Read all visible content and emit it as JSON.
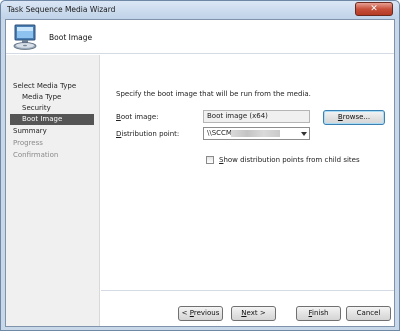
{
  "window": {
    "title": "Task Sequence Media Wizard",
    "close_glyph": "✕"
  },
  "header": {
    "title": "Boot Image",
    "icon": "computer-media-icon"
  },
  "nav": {
    "items": [
      {
        "label": "Select Media Type",
        "level": "top",
        "state": "normal"
      },
      {
        "label": "Media Type",
        "level": "sub",
        "state": "normal"
      },
      {
        "label": "Security",
        "level": "sub",
        "state": "normal"
      },
      {
        "label": "Boot Image",
        "level": "sub",
        "state": "selected"
      },
      {
        "label": "Summary",
        "level": "top",
        "state": "normal"
      },
      {
        "label": "Progress",
        "level": "top",
        "state": "disabled"
      },
      {
        "label": "Confirmation",
        "level": "top",
        "state": "disabled"
      }
    ]
  },
  "main": {
    "instruction": "Specify the boot image that will be run from the media.",
    "boot_image": {
      "label_prefix": "B",
      "label_rest": "oot image:",
      "value": "Boot image (x64)"
    },
    "browse_button": {
      "label_prefix": "B",
      "label_rest": "rowse..."
    },
    "distribution_point": {
      "label_prefix": "D",
      "label_rest": "istribution point:",
      "value": "\\\\SCCM"
    },
    "show_child_sites": {
      "label_prefix": "S",
      "label_rest": "how distribution points from child sites",
      "checked": false
    }
  },
  "footer": {
    "previous": {
      "prefix": "< ",
      "underline": "P",
      "rest": "revious"
    },
    "next": {
      "prefix": "",
      "underline": "N",
      "rest": "ext >"
    },
    "finish": {
      "prefix": "",
      "underline": "F",
      "rest": "inish"
    },
    "cancel": {
      "label": "Cancel"
    }
  }
}
